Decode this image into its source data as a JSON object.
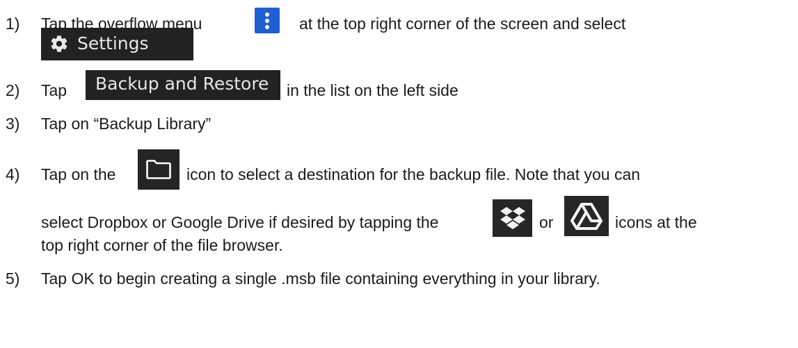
{
  "steps": [
    {
      "number": "1)",
      "text_before_icon": "Tap the overflow menu",
      "text_after_icon": "at the top right corner of the screen and select",
      "settings_label": "Settings"
    },
    {
      "number": "2)",
      "text_before": "Tap",
      "button_label": "Backup and Restore",
      "text_after": "in the list on the left side"
    },
    {
      "number": "3)",
      "text": "Tap on “Backup Library”"
    },
    {
      "number": "4)",
      "text_before_icon": "Tap on the",
      "text_after_icon": "icon to select a destination for the backup file. Note that you can",
      "line2_before": "select Dropbox or Google Drive if desired by tapping the",
      "line2_or": "or",
      "line2_after": "icons at the",
      "line3": "top right corner of the file browser."
    },
    {
      "number": "5)",
      "text": "Tap OK to begin creating a single .msb file containing everything in your library."
    }
  ],
  "icons": {
    "overflow_menu": "more-vert-icon",
    "settings": "gear-icon",
    "folder": "folder-icon",
    "dropbox": "dropbox-icon",
    "google_drive": "google-drive-icon"
  },
  "colors": {
    "overflow_menu_bg": "#1f5fd1",
    "chip_bg": "#222222",
    "text": "#1b1b1b"
  }
}
